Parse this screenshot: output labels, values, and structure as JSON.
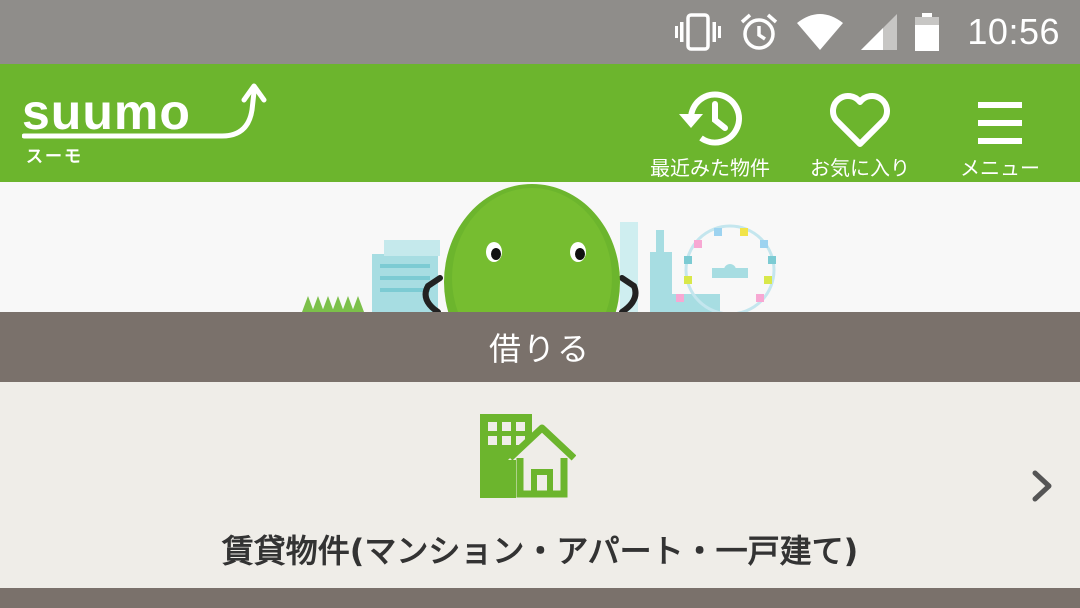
{
  "status_bar": {
    "time": "10:56",
    "icons": [
      "vibrate-icon",
      "alarm-icon",
      "wifi-icon",
      "cell-signal-icon",
      "battery-icon"
    ]
  },
  "header": {
    "logo_text": "suumo",
    "logo_sub": "スーモ",
    "recent_label": "最近みた物件",
    "favorites_label": "お気に入り",
    "menu_label": "メニュー",
    "brand_color": "#6cb52d"
  },
  "section": {
    "title": "借りる",
    "color": "#7a716b"
  },
  "item": {
    "label": "賃貸物件(マンション・アパート・一戸建て)",
    "icon": "apartment-house-icon"
  }
}
